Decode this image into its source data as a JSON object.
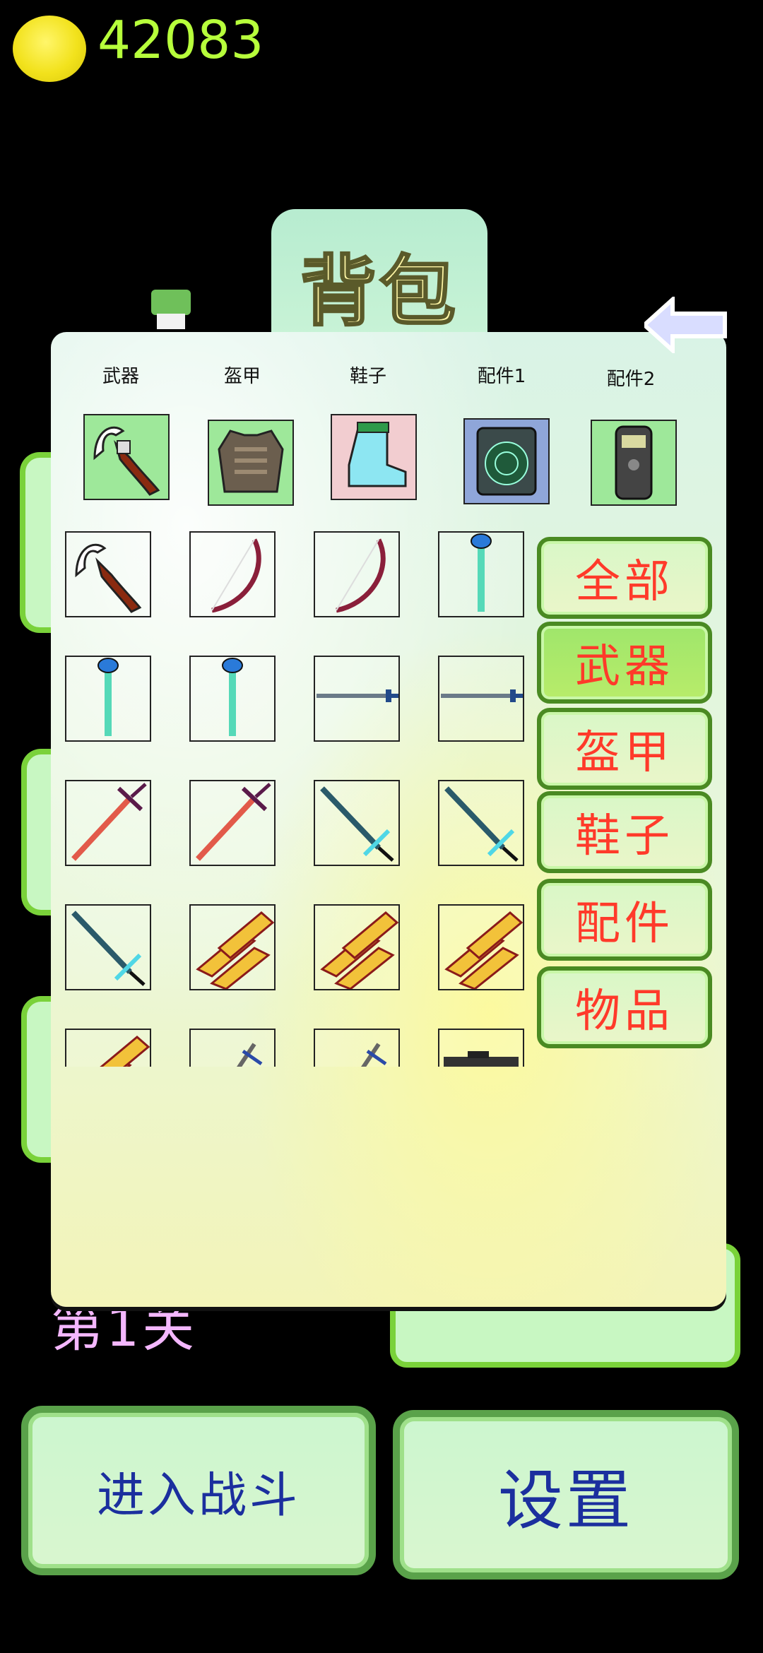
{
  "header": {
    "coin_count": "42083"
  },
  "background": {
    "stage_label": "第1关"
  },
  "backpack": {
    "title": "背包",
    "slot_labels": [
      "武器",
      "盔甲",
      "鞋子",
      "配件1",
      "配件2"
    ],
    "categories": [
      "全部",
      "武器",
      "盔甲",
      "鞋子",
      "配件",
      "物品"
    ],
    "active_category": "武器"
  },
  "bottom": {
    "fight_label": "进入战斗",
    "settings_label": "设置"
  },
  "colors": {
    "coin_text": "#b7ff3b",
    "category_text": "#ff3a2a",
    "bottom_text": "#1b2f9e",
    "stage_text": "#f4b7ff"
  },
  "icons": {
    "equipped": [
      "hook-weapon-icon",
      "armor-vest-icon",
      "blue-boot-icon",
      "radar-device-icon",
      "scanner-device-icon"
    ],
    "inventory": [
      "hook-weapon-icon",
      "red-bow-icon",
      "red-bow-icon",
      "blue-staff-icon",
      "blue-staff-icon",
      "blue-staff-icon",
      "long-sword-icon",
      "long-sword-icon",
      "red-sword-icon",
      "red-sword-icon",
      "teal-sword-icon",
      "teal-sword-icon",
      "teal-sword-icon",
      "arrow-bundle-icon",
      "arrow-bundle-icon",
      "arrow-bundle-icon",
      "arrow-bundle-icon",
      "steel-sword-icon",
      "steel-sword-icon",
      "rifle-icon"
    ]
  }
}
